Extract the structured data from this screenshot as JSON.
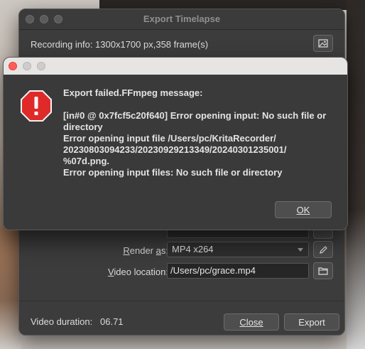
{
  "timelapse": {
    "title": "Export Timelapse",
    "recording_info": "Recording info: 1300x1700 px,358 frame(s)",
    "render_as_label": "Render as:",
    "render_as_value": "MP4 x264",
    "video_location_label": "Video location:",
    "video_location_value": "/Users/pc/grace.mp4",
    "video_duration_label": "Video duration:",
    "video_duration_value": "06.71",
    "close_label": "Close",
    "export_label": "Export"
  },
  "error_dialog": {
    "heading": "Export failed.FFmpeg message:",
    "message": "[in#0 @ 0x7fcf5c20f640] Error opening input: No such file or directory\nError opening input file /Users/pc/KritaRecorder/\n20230803094233/20230929213349/20240301235001/\n%07d.png.\nError opening input files: No such file or directory",
    "ok_label": "OK"
  },
  "icons": {
    "error": "error-octagon-icon",
    "image": "image-icon",
    "edit": "pencil-icon",
    "folder": "folder-icon"
  },
  "colors": {
    "error_red": "#e02a2a",
    "close_light": "#ff5f57"
  }
}
